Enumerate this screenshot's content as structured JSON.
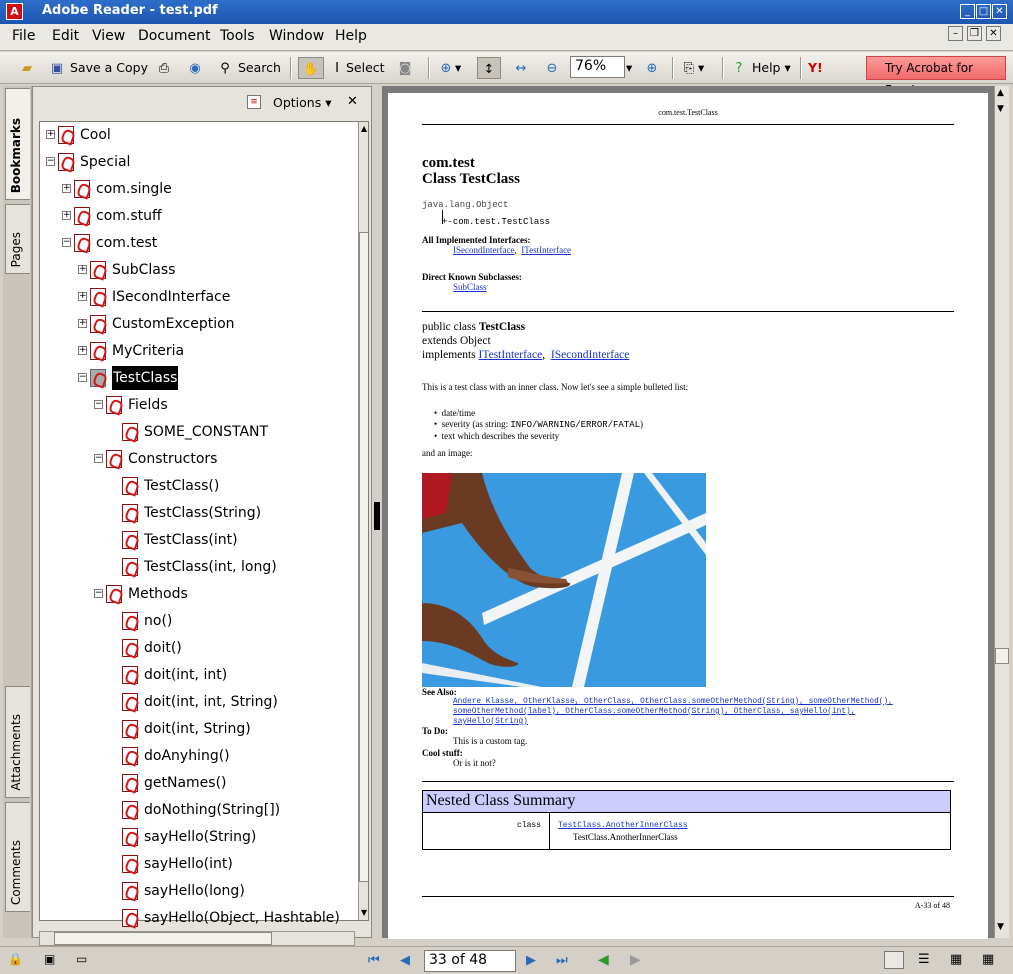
{
  "window": {
    "title": "Adobe Reader - test.pdf",
    "min": "_",
    "max": "□",
    "close": "✕"
  },
  "menu": [
    "File",
    "Edit",
    "View",
    "Document",
    "Tools",
    "Window",
    "Help"
  ],
  "toolbar": {
    "save_copy": "Save a Copy",
    "search": "Search",
    "select": "Select",
    "zoom": "76%",
    "help": "Help",
    "try": "Try Acrobat for Free!"
  },
  "tabs": {
    "bookmarks": "Bookmarks",
    "pages": "Pages",
    "attachments": "Attachments",
    "comments": "Comments"
  },
  "panel": {
    "options": "Options",
    "close": "✕"
  },
  "tree": [
    {
      "label": "Cool"
    },
    {
      "label": "Special"
    },
    {
      "label": "com.single"
    },
    {
      "label": "com.stuff"
    },
    {
      "label": "com.test"
    },
    {
      "label": "SubClass"
    },
    {
      "label": "ISecondInterface"
    },
    {
      "label": "CustomException"
    },
    {
      "label": "MyCriteria"
    },
    {
      "label": "TestClass"
    },
    {
      "label": "Fields"
    },
    {
      "label": "SOME_CONSTANT"
    },
    {
      "label": "Constructors"
    },
    {
      "label": "TestClass()"
    },
    {
      "label": "TestClass(String)"
    },
    {
      "label": "TestClass(int)"
    },
    {
      "label": "TestClass(int, long)"
    },
    {
      "label": "Methods"
    },
    {
      "label": "no()"
    },
    {
      "label": "doit()"
    },
    {
      "label": "doit(int, int)"
    },
    {
      "label": "doit(int, int, String)"
    },
    {
      "label": "doit(int, String)"
    },
    {
      "label": "doAnyhing()"
    },
    {
      "label": "getNames()"
    },
    {
      "label": "doNothing(String[])"
    },
    {
      "label": "sayHello(String)"
    },
    {
      "label": "sayHello(int)"
    },
    {
      "label": "sayHello(long)"
    },
    {
      "label": "sayHello(Object, Hashtable)"
    }
  ],
  "doc": {
    "header": "com.test.TestClass",
    "pkg": "com.test",
    "cls": "Class TestClass",
    "inh1": "java.lang.Object",
    "inh2": "com.test.TestClass",
    "impl_h": "All Implemented Interfaces:",
    "impl1": "ISecondInterface",
    "impl2": "ITestInterface",
    "sub_h": "Direct Known Subclasses:",
    "sub1": "SubClass",
    "decl1a": "public class ",
    "decl1b": "TestClass",
    "decl2": "extends Object",
    "decl3": "implements ",
    "decl3a": "ITestInterface",
    "decl3b": "ISecondInterface",
    "desc": "This is a test class with an inner class. Now let's see a simple bulleted list:",
    "b1": "date/time",
    "b2a": "severity (as string: ",
    "b2b": "INFO/WARNING/ERROR/FATAL",
    "b2c": ")",
    "b3": "text which describes the severity",
    "img_intro": "and an image:",
    "see_h": "See Also:",
    "see1": "Andere Klasse, OtherKlasse, OtherClass, OtherClass.someOtherMethod(String), someOtherMethod(),",
    "see2": "someOtherMethod(label), OtherClass.someOtherMethod(String), OtherClass, sayHello(int),",
    "see3": "sayHello(String)",
    "todo_h": "To Do:",
    "todo": "This is a custom tag.",
    "cool_h": "Cool stuff:",
    "cool": "Or is it not?",
    "nested_h": "Nested Class Summary",
    "nested_mod": "class",
    "nested_link": "TestClass.AnotherInnerClass",
    "nested_desc": "TestClass.AnotherInnerClass",
    "footer": "A-33 of 48"
  },
  "status": {
    "page": "33 of 48"
  }
}
